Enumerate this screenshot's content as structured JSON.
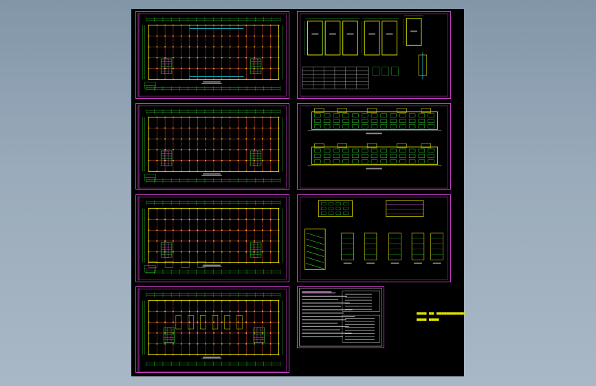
{
  "viewport": {
    "label": "drawing-model-space"
  },
  "colors": {
    "background": "#000000",
    "frame": "#c83ec8",
    "grid": "#e23a3a",
    "wall": "#e6e600",
    "dimension": "#2ee02e",
    "text": "#ffffff",
    "accent": "#ff66ff",
    "cyan": "#29d3e6"
  },
  "sheets": [
    {
      "id": "plan-1",
      "type": "floor-plan"
    },
    {
      "id": "plan-2",
      "type": "floor-plan"
    },
    {
      "id": "plan-3",
      "type": "floor-plan"
    },
    {
      "id": "plan-4",
      "type": "floor-plan"
    },
    {
      "id": "column-details",
      "type": "detail"
    },
    {
      "id": "elevations",
      "type": "elevation"
    },
    {
      "id": "sections-stairs",
      "type": "section"
    },
    {
      "id": "design-notes",
      "type": "notes"
    }
  ],
  "side_note": {
    "line1": "■■■■ ■■ ■■■■■■■■■■■■■■",
    "line2": "■■■■ ■■■■"
  }
}
